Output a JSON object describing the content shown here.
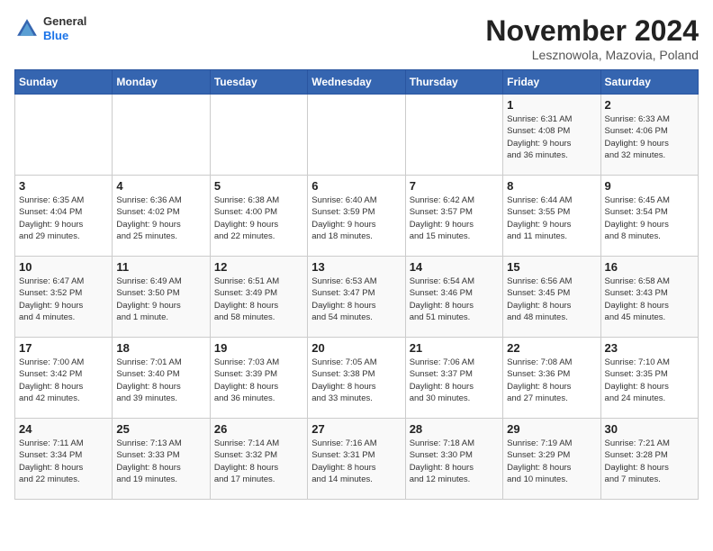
{
  "header": {
    "logo_general": "General",
    "logo_blue": "Blue",
    "month_title": "November 2024",
    "location": "Lesznowola, Mazovia, Poland"
  },
  "weekdays": [
    "Sunday",
    "Monday",
    "Tuesday",
    "Wednesday",
    "Thursday",
    "Friday",
    "Saturday"
  ],
  "weeks": [
    [
      {
        "day": "",
        "info": ""
      },
      {
        "day": "",
        "info": ""
      },
      {
        "day": "",
        "info": ""
      },
      {
        "day": "",
        "info": ""
      },
      {
        "day": "",
        "info": ""
      },
      {
        "day": "1",
        "info": "Sunrise: 6:31 AM\nSunset: 4:08 PM\nDaylight: 9 hours\nand 36 minutes."
      },
      {
        "day": "2",
        "info": "Sunrise: 6:33 AM\nSunset: 4:06 PM\nDaylight: 9 hours\nand 32 minutes."
      }
    ],
    [
      {
        "day": "3",
        "info": "Sunrise: 6:35 AM\nSunset: 4:04 PM\nDaylight: 9 hours\nand 29 minutes."
      },
      {
        "day": "4",
        "info": "Sunrise: 6:36 AM\nSunset: 4:02 PM\nDaylight: 9 hours\nand 25 minutes."
      },
      {
        "day": "5",
        "info": "Sunrise: 6:38 AM\nSunset: 4:00 PM\nDaylight: 9 hours\nand 22 minutes."
      },
      {
        "day": "6",
        "info": "Sunrise: 6:40 AM\nSunset: 3:59 PM\nDaylight: 9 hours\nand 18 minutes."
      },
      {
        "day": "7",
        "info": "Sunrise: 6:42 AM\nSunset: 3:57 PM\nDaylight: 9 hours\nand 15 minutes."
      },
      {
        "day": "8",
        "info": "Sunrise: 6:44 AM\nSunset: 3:55 PM\nDaylight: 9 hours\nand 11 minutes."
      },
      {
        "day": "9",
        "info": "Sunrise: 6:45 AM\nSunset: 3:54 PM\nDaylight: 9 hours\nand 8 minutes."
      }
    ],
    [
      {
        "day": "10",
        "info": "Sunrise: 6:47 AM\nSunset: 3:52 PM\nDaylight: 9 hours\nand 4 minutes."
      },
      {
        "day": "11",
        "info": "Sunrise: 6:49 AM\nSunset: 3:50 PM\nDaylight: 9 hours\nand 1 minute."
      },
      {
        "day": "12",
        "info": "Sunrise: 6:51 AM\nSunset: 3:49 PM\nDaylight: 8 hours\nand 58 minutes."
      },
      {
        "day": "13",
        "info": "Sunrise: 6:53 AM\nSunset: 3:47 PM\nDaylight: 8 hours\nand 54 minutes."
      },
      {
        "day": "14",
        "info": "Sunrise: 6:54 AM\nSunset: 3:46 PM\nDaylight: 8 hours\nand 51 minutes."
      },
      {
        "day": "15",
        "info": "Sunrise: 6:56 AM\nSunset: 3:45 PM\nDaylight: 8 hours\nand 48 minutes."
      },
      {
        "day": "16",
        "info": "Sunrise: 6:58 AM\nSunset: 3:43 PM\nDaylight: 8 hours\nand 45 minutes."
      }
    ],
    [
      {
        "day": "17",
        "info": "Sunrise: 7:00 AM\nSunset: 3:42 PM\nDaylight: 8 hours\nand 42 minutes."
      },
      {
        "day": "18",
        "info": "Sunrise: 7:01 AM\nSunset: 3:40 PM\nDaylight: 8 hours\nand 39 minutes."
      },
      {
        "day": "19",
        "info": "Sunrise: 7:03 AM\nSunset: 3:39 PM\nDaylight: 8 hours\nand 36 minutes."
      },
      {
        "day": "20",
        "info": "Sunrise: 7:05 AM\nSunset: 3:38 PM\nDaylight: 8 hours\nand 33 minutes."
      },
      {
        "day": "21",
        "info": "Sunrise: 7:06 AM\nSunset: 3:37 PM\nDaylight: 8 hours\nand 30 minutes."
      },
      {
        "day": "22",
        "info": "Sunrise: 7:08 AM\nSunset: 3:36 PM\nDaylight: 8 hours\nand 27 minutes."
      },
      {
        "day": "23",
        "info": "Sunrise: 7:10 AM\nSunset: 3:35 PM\nDaylight: 8 hours\nand 24 minutes."
      }
    ],
    [
      {
        "day": "24",
        "info": "Sunrise: 7:11 AM\nSunset: 3:34 PM\nDaylight: 8 hours\nand 22 minutes."
      },
      {
        "day": "25",
        "info": "Sunrise: 7:13 AM\nSunset: 3:33 PM\nDaylight: 8 hours\nand 19 minutes."
      },
      {
        "day": "26",
        "info": "Sunrise: 7:14 AM\nSunset: 3:32 PM\nDaylight: 8 hours\nand 17 minutes."
      },
      {
        "day": "27",
        "info": "Sunrise: 7:16 AM\nSunset: 3:31 PM\nDaylight: 8 hours\nand 14 minutes."
      },
      {
        "day": "28",
        "info": "Sunrise: 7:18 AM\nSunset: 3:30 PM\nDaylight: 8 hours\nand 12 minutes."
      },
      {
        "day": "29",
        "info": "Sunrise: 7:19 AM\nSunset: 3:29 PM\nDaylight: 8 hours\nand 10 minutes."
      },
      {
        "day": "30",
        "info": "Sunrise: 7:21 AM\nSunset: 3:28 PM\nDaylight: 8 hours\nand 7 minutes."
      }
    ]
  ]
}
